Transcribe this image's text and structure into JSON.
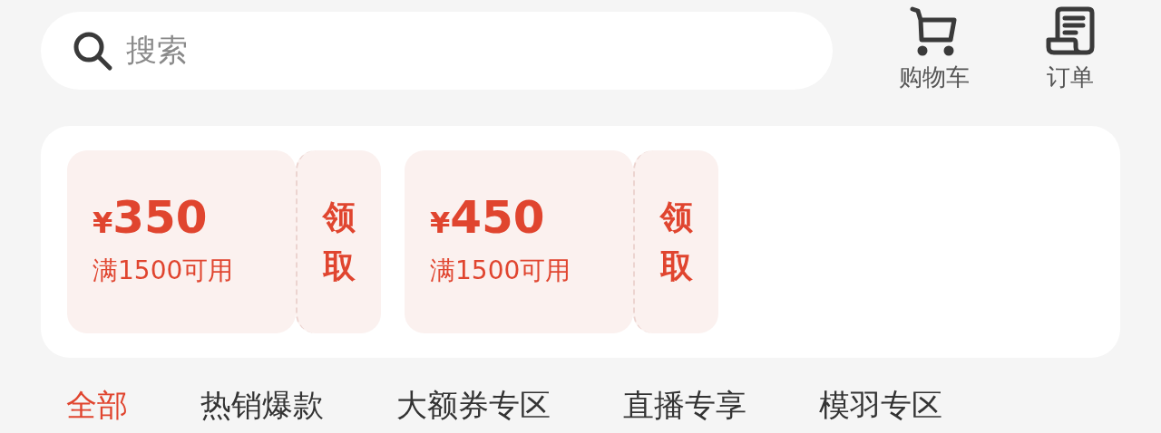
{
  "search": {
    "placeholder": "搜索"
  },
  "shortcuts": [
    {
      "kind": "cart",
      "label": "购物车"
    },
    {
      "kind": "order",
      "label": "订单"
    }
  ],
  "coupons": [
    {
      "currency": "¥",
      "amount": "350",
      "condition": "满1500可用",
      "action": "领取"
    },
    {
      "currency": "¥",
      "amount": "450",
      "condition": "满1500可用",
      "action": "领取"
    }
  ],
  "tabs": [
    {
      "label": "全部",
      "selected": true
    },
    {
      "label": "热销爆款",
      "selected": false
    },
    {
      "label": "大额券专区",
      "selected": false
    },
    {
      "label": "直播专享",
      "selected": false
    },
    {
      "label": "模羽专区",
      "selected": false
    }
  ]
}
